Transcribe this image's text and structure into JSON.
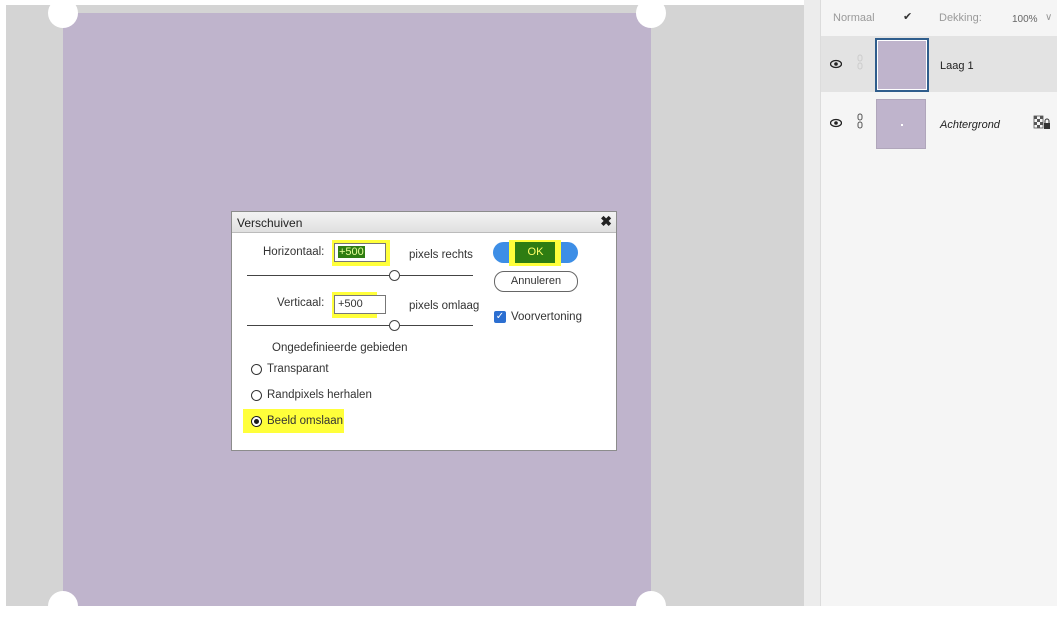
{
  "layers_panel": {
    "blend_mode": "Normaal",
    "opacity_label": "Dekking:",
    "opacity_value": "100%",
    "layers": [
      {
        "name": "Laag 1",
        "selected": true
      },
      {
        "name": "Achtergrond",
        "locked": true
      }
    ]
  },
  "dialog": {
    "title": "Verschuiven",
    "horizontal_label": "Horizontaal:",
    "horizontal_value": "+500",
    "horizontal_unit": "pixels rechts",
    "vertical_label": "Verticaal:",
    "vertical_value": "+500",
    "vertical_unit": "pixels omlaag",
    "ok_label": "OK",
    "cancel_label": "Annuleren",
    "preview_label": "Voorvertoning",
    "preview_checked": true,
    "undefined_areas_label": "Ongedefinieerde gebieden",
    "options": [
      {
        "label": "Transparant",
        "selected": false
      },
      {
        "label": "Randpixels herhalen",
        "selected": false
      },
      {
        "label": "Beeld omslaan",
        "selected": true
      }
    ]
  },
  "colors": {
    "canvas": "#bfb4cc",
    "highlight": "#ffff3a",
    "ok_button": "#3d8ee6",
    "selection_green": "#2e7d12"
  }
}
